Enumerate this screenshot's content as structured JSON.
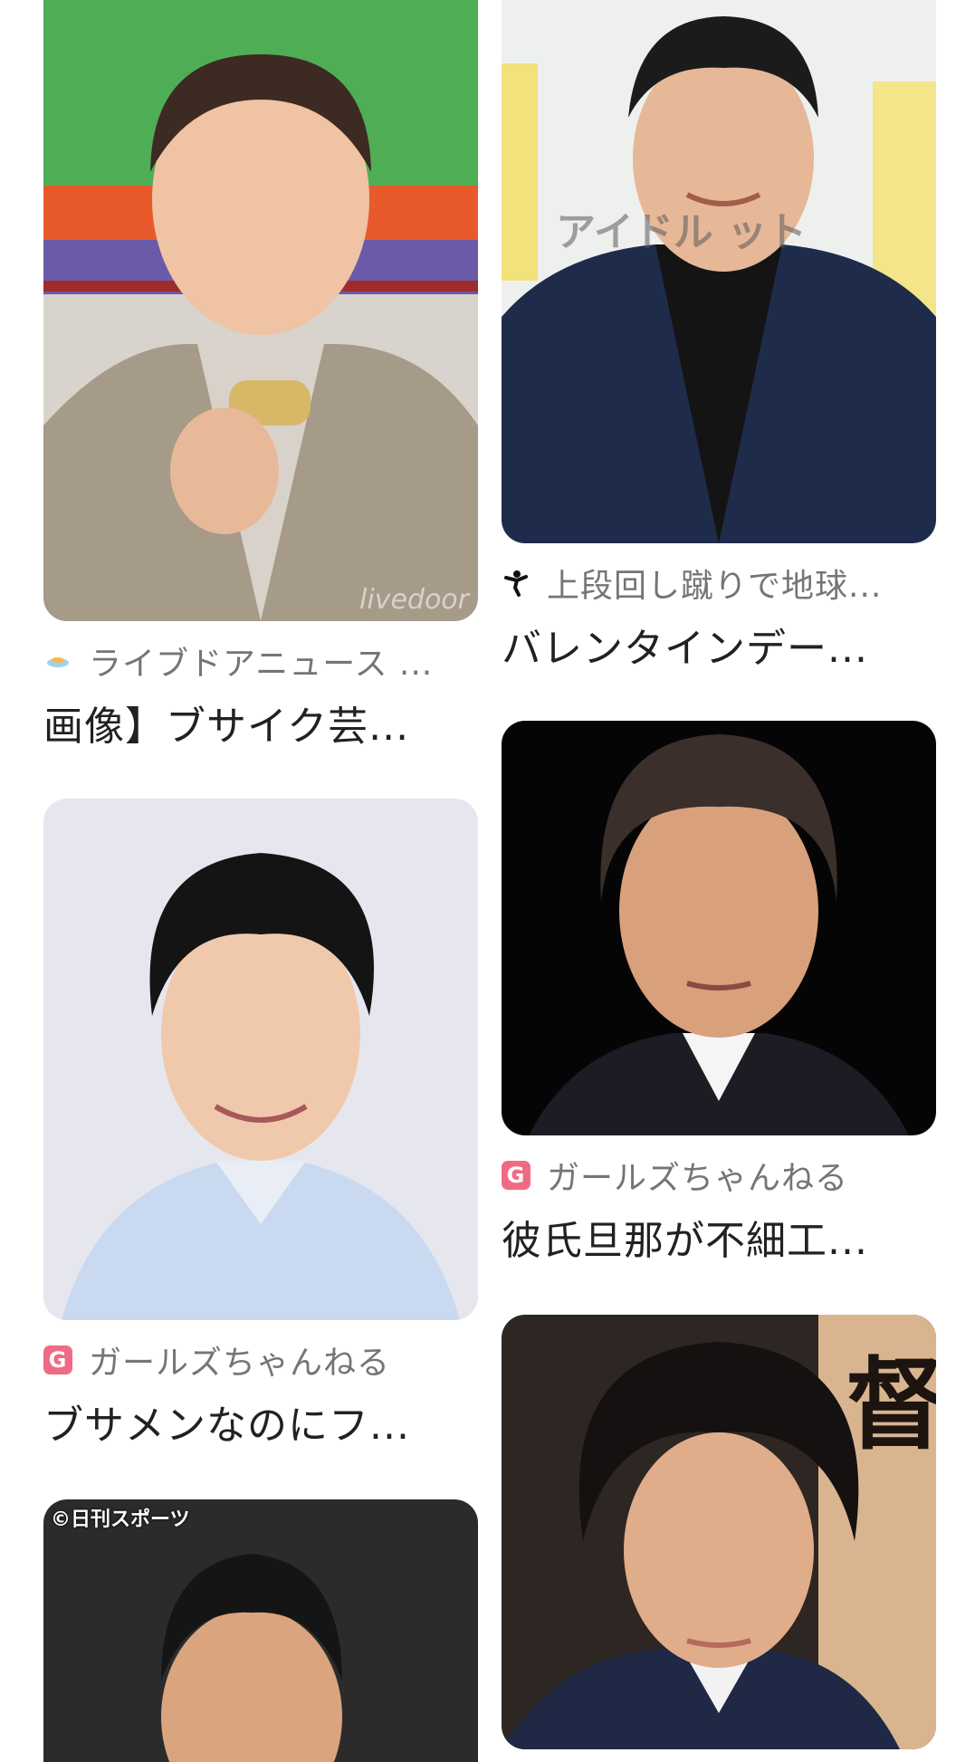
{
  "results": {
    "left": [
      {
        "source_icon": "livedoor-icon",
        "source": "ライブドアニュース ...",
        "title": "画像】ブサイク芸...",
        "watermark": "livedoor"
      },
      {
        "source_icon": "girlschannel-g-icon",
        "source_icon_letter": "G",
        "source": "ガールズちゃんねる",
        "title": "ブサメンなのにフ..."
      },
      {
        "stamp": "©日刊スポーツ"
      }
    ],
    "right": [
      {
        "source_icon": "karate-kick-icon",
        "source": "上段回し蹴りで地球...",
        "title": "バレンタインデー...",
        "sign_text": "アイドル ット"
      },
      {
        "source_icon": "girlschannel-g-icon",
        "source_icon_letter": "G",
        "source": "ガールズちゃんねる",
        "title": "彼氏旦那が不細工..."
      },
      {
        "banner_text": "督"
      }
    ]
  },
  "colors": {
    "source_text": "#757575",
    "title_text": "#202124",
    "girlschannel_brand": "#f06a86"
  }
}
